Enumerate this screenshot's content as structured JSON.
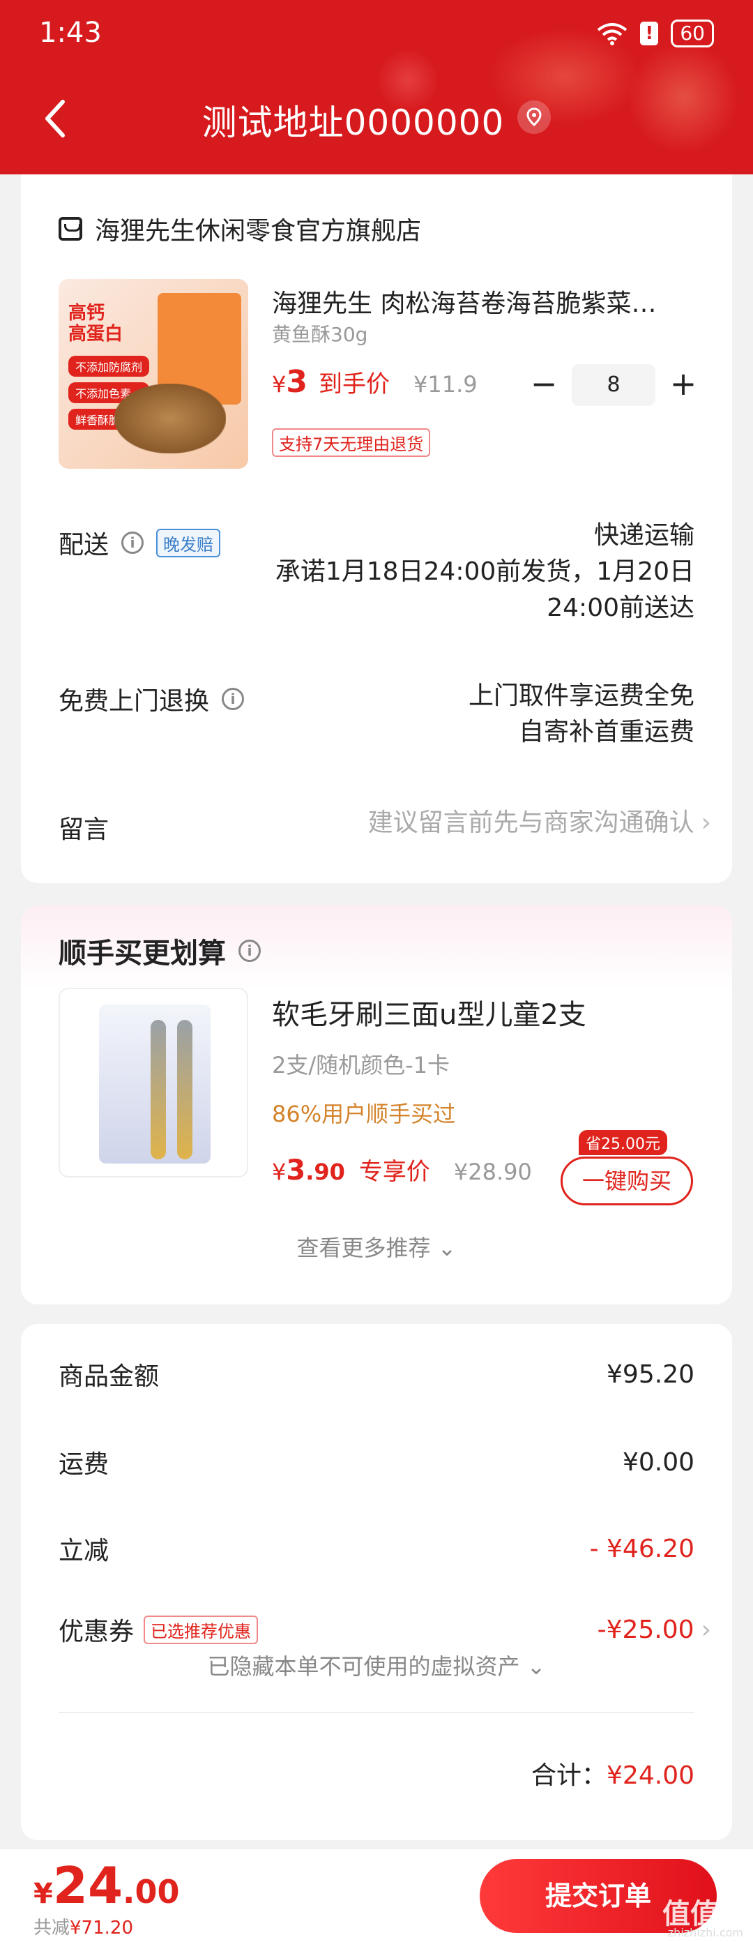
{
  "status_bar": {
    "time": "1:43",
    "battery": "60"
  },
  "header": {
    "title": "测试地址0000000",
    "back_icon": "back-arrow-icon",
    "location_icon": "location-pin-icon"
  },
  "shop": {
    "name": "海狸先生休闲零食官方旗舰店",
    "icon": "store-icon"
  },
  "product": {
    "name": "海狸先生 肉松海苔卷海苔脆紫菜…",
    "spec": "黄鱼酥30g",
    "currency": "¥",
    "price": "3",
    "price_label": "到手价",
    "original_price": "¥11.9",
    "quantity": "8",
    "minus": "−",
    "plus": "+",
    "return_policy": "支持7天无理由退货",
    "image_text": {
      "tag_line1": "高钙",
      "tag_line2": "高蛋白",
      "pills": [
        "不添加防腐剂",
        "不添加色素",
        "鲜香酥脆"
      ]
    }
  },
  "delivery": {
    "label": "配送",
    "badge": "晚发赔",
    "method": "快递运输",
    "promise_line1": "承诺1月18日24:00前发货，1月20日",
    "promise_line2": "24:00前送达"
  },
  "pickup": {
    "label": "免费上门退换",
    "line1": "上门取件享运费全免",
    "line2": "自寄补首重运费"
  },
  "message": {
    "label": "留言",
    "placeholder": "建议留言前先与商家沟通确认",
    "chevron": "›"
  },
  "upsell": {
    "title": "顺手买更划算",
    "name": "软毛牙刷三面u型儿童2支",
    "spec": "2支/随机颜色-1卡",
    "stat": "86%用户顺手买过",
    "currency": "¥",
    "price_int": "3",
    "price_dec": ".90",
    "price_label": "专享价",
    "original_price": "¥28.90",
    "save_badge": "省25.00元",
    "buy_button": "一键购买",
    "more": "查看更多推荐 ⌄"
  },
  "summary": {
    "goods_label": "商品金额",
    "goods_value": "¥95.20",
    "shipping_label": "运费",
    "shipping_value": "¥0.00",
    "discount_label": "立减",
    "discount_value": "- ¥46.20",
    "coupon_label": "优惠券",
    "coupon_badge": "已选推荐优惠",
    "coupon_value": "-¥25.00",
    "coupon_chevron": "›",
    "hidden_note": "已隐藏本单不可使用的虚拟资产 ⌄",
    "total_label": "合计：",
    "total_value": "¥24.00"
  },
  "footer": {
    "currency": "¥",
    "amount_int": "24",
    "amount_dec": ".00",
    "saved_label": "共减",
    "saved_value": "¥71.20",
    "submit": "提交订单",
    "watermark": "值值值",
    "watermark_sub": "zhizhizhi.com"
  },
  "colors": {
    "brand_red": "#d71a1d",
    "accent_red": "#e0231c",
    "orange": "#d4832a"
  }
}
